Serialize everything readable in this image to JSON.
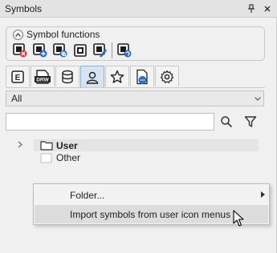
{
  "panel": {
    "title": "Symbols"
  },
  "symbol_functions": {
    "label": "Symbol functions",
    "buttons": [
      {
        "name": "delete-symbol-icon"
      },
      {
        "name": "add-symbol-icon"
      },
      {
        "name": "copy-symbol-icon"
      },
      {
        "name": "select-symbol-icon"
      },
      {
        "name": "edit-symbol-icon"
      },
      {
        "name": "replace-symbol-icon"
      }
    ]
  },
  "tabs": [
    {
      "name": "tab-e",
      "glyph": "E"
    },
    {
      "name": "tab-drw",
      "glyph": "DRW"
    },
    {
      "name": "tab-database",
      "glyph": ""
    },
    {
      "name": "tab-user",
      "glyph": ""
    },
    {
      "name": "tab-favorites",
      "glyph": "☆"
    },
    {
      "name": "tab-document",
      "glyph": ""
    },
    {
      "name": "tab-settings",
      "glyph": "⚙"
    }
  ],
  "filter": {
    "selected": "All"
  },
  "search": {
    "value": "",
    "placeholder": ""
  },
  "tree": {
    "items": [
      {
        "label": "User",
        "expanded": false,
        "selected": true
      },
      {
        "label": "Other",
        "expanded": false,
        "selected": false
      }
    ]
  },
  "context_menu": {
    "items": [
      {
        "label": "Folder...",
        "has_submenu": true
      },
      {
        "label": "Import symbols from user icon menus",
        "has_submenu": false
      }
    ]
  },
  "colors": {
    "accent_blue": "#2b6cc4",
    "delete_red": "#d93b3b",
    "tab_active_bg": "#d6e4f2"
  }
}
